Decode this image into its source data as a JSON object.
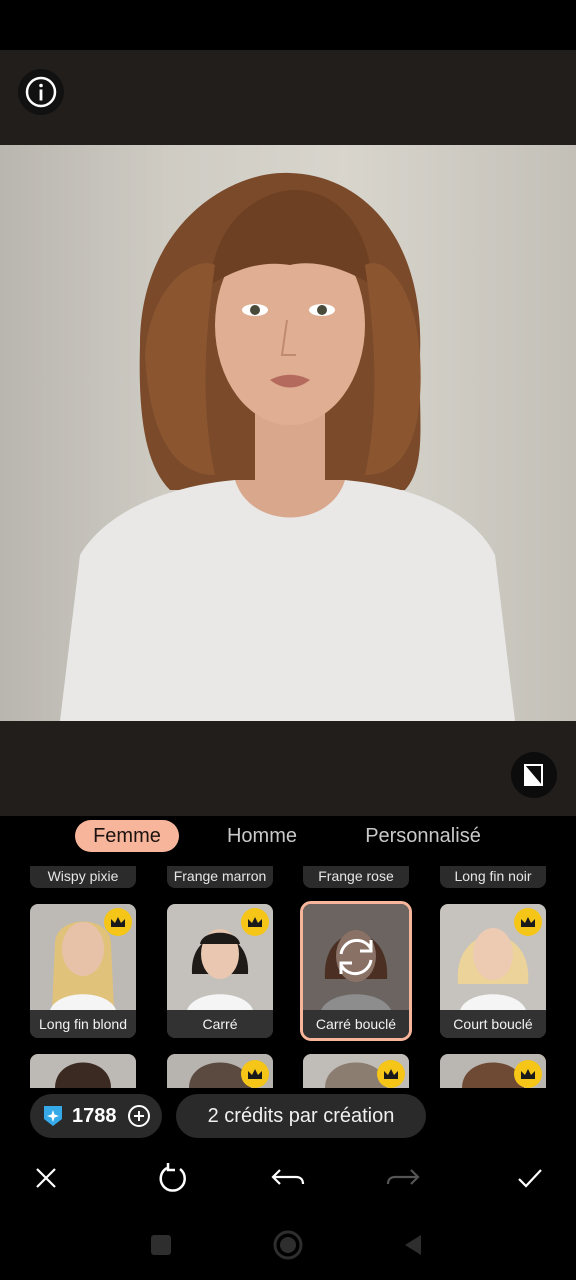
{
  "tabs": [
    "Femme",
    "Homme",
    "Personnalisé"
  ],
  "top_row_labels": [
    "Wispy pixie",
    "Frange marron",
    "Frange rose",
    "Long fin noir"
  ],
  "styles": [
    {
      "label": "Long fin blond",
      "premium": true,
      "selected": false
    },
    {
      "label": "Carré",
      "premium": true,
      "selected": false
    },
    {
      "label": "Carré bouclé",
      "premium": false,
      "selected": true
    },
    {
      "label": "Court bouclé",
      "premium": true,
      "selected": false
    }
  ],
  "credits": {
    "value": "1788"
  },
  "tip": {
    "text": "2 crédits par création"
  },
  "icons": {
    "info": "info-icon",
    "compare": "compare-icon",
    "crown": "crown-icon",
    "regenerate": "regenerate-icon",
    "close": "close-icon",
    "redo-refresh": "refresh-icon",
    "undo": "undo-icon",
    "redo": "redo-icon",
    "confirm": "check-icon"
  },
  "colors": {
    "accent": "#f7b69b",
    "premium": "#f5c518",
    "panel": "#221e1c"
  }
}
